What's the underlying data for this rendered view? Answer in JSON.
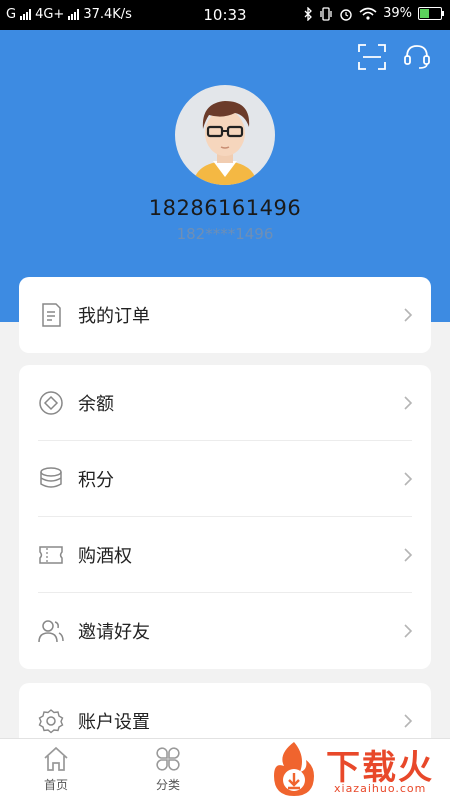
{
  "status_bar": {
    "carrier": "G",
    "network": "4G+",
    "speed": "37.4K/s",
    "time": "10:33",
    "battery_pct": "39%",
    "battery_level": 0.39
  },
  "header": {
    "scan_icon": "scan-icon",
    "service_icon": "headset-icon",
    "phone": "18286161496",
    "masked_phone": "182****1496",
    "bg_color": "#3d8be2"
  },
  "orders": {
    "label": "我的订单",
    "icon": "document-icon"
  },
  "menu": [
    {
      "label": "余额",
      "icon": "balance-icon"
    },
    {
      "label": "积分",
      "icon": "coins-icon"
    },
    {
      "label": "购酒权",
      "icon": "ticket-icon"
    },
    {
      "label": "邀请好友",
      "icon": "users-icon"
    }
  ],
  "settings": {
    "label": "账户设置",
    "icon": "gear-icon"
  },
  "tabbar": [
    {
      "label": "首页",
      "icon": "home-icon"
    },
    {
      "label": "分类",
      "icon": "category-icon"
    }
  ],
  "watermark": {
    "text": "下载火",
    "sub": "xiazaihuo.com"
  }
}
